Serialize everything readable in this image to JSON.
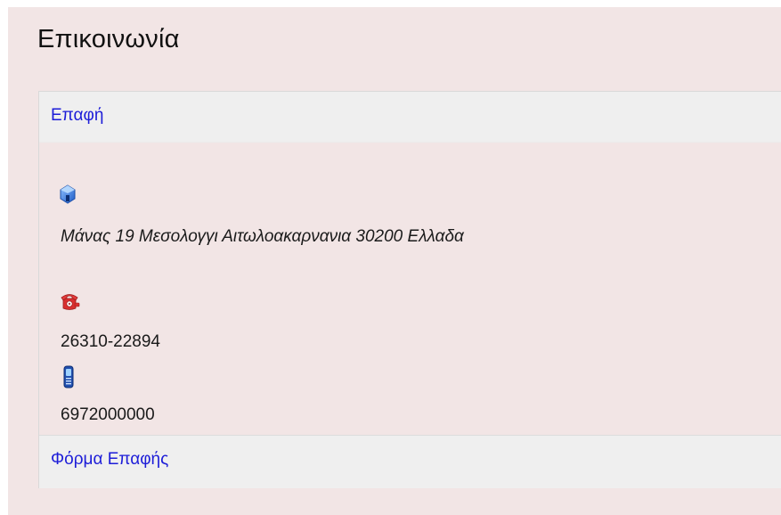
{
  "page": {
    "title": "Επικοινωνία"
  },
  "contact_panel": {
    "header_link": "Επαφή",
    "address_icon": "house-icon",
    "address": "Μάνας 19 Μεσολογγι Αιτωλοακαρνανια 30200 Ελλαδα",
    "phone_icon": "telephone-icon",
    "phone": "26310-22894",
    "mobile_icon": "mobile-phone-icon",
    "mobile": "6972000000",
    "footer_link": "Φόρμα Επαφής"
  },
  "colors": {
    "page_background": "#f2e5e5",
    "panel_header_background": "#efefef",
    "link": "#1d1dd8",
    "address_icon": "#2b6fd6",
    "phone_icon": "#e23b3b",
    "mobile_icon": "#1f4fae"
  }
}
